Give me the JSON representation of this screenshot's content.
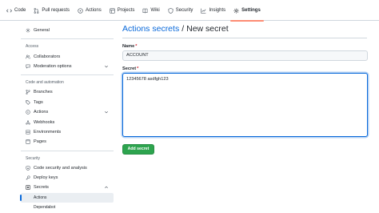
{
  "repo_nav": {
    "tabs": [
      {
        "label": "Code",
        "icon": "code-icon"
      },
      {
        "label": "Pull requests",
        "icon": "pull-request-icon"
      },
      {
        "label": "Actions",
        "icon": "play-circle-icon"
      },
      {
        "label": "Projects",
        "icon": "table-icon"
      },
      {
        "label": "Wiki",
        "icon": "book-icon"
      },
      {
        "label": "Security",
        "icon": "shield-icon"
      },
      {
        "label": "Insights",
        "icon": "graph-icon"
      },
      {
        "label": "Settings",
        "icon": "gear-icon",
        "active": true
      }
    ],
    "active_underline_color": "#fd8c73"
  },
  "sidebar": {
    "general": "General",
    "access_group": "Access",
    "collaborators": "Collaborators",
    "moderation_options": "Moderation options",
    "code_automation_group": "Code and automation",
    "branches": "Branches",
    "tags": "Tags",
    "actions": "Actions",
    "webhooks": "Webhooks",
    "environments": "Environments",
    "pages": "Pages",
    "security_group": "Security",
    "code_security": "Code security and analysis",
    "deploy_keys": "Deploy keys",
    "secrets": "Secrets",
    "secrets_actions": "Actions",
    "secrets_dependabot": "Dependabot"
  },
  "main": {
    "breadcrumb_link": "Actions secrets",
    "breadcrumb_sep": "/",
    "breadcrumb_current": "New secret",
    "name_label": "Name",
    "name_value": "ACCOUNT",
    "secret_label": "Secret",
    "secret_value": "12345678 asdfgh123",
    "required_mark": "*",
    "add_button": "Add secret"
  },
  "colors": {
    "link": "#0969da",
    "primary_button": "#2da44e",
    "required": "#cf222e",
    "selected_indicator": "#0969da"
  }
}
